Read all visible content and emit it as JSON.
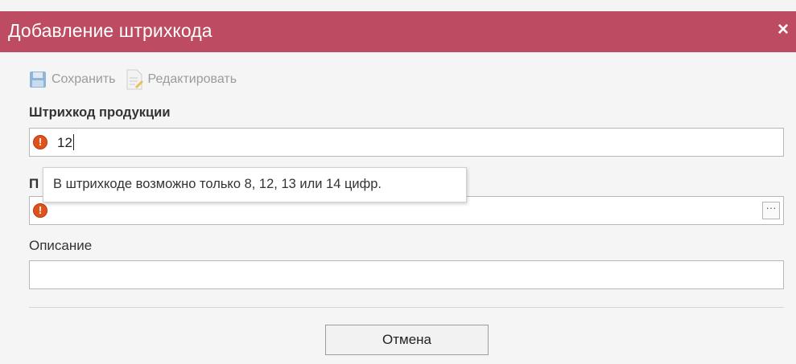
{
  "dialog": {
    "title": "Добавление штрихкода",
    "close_glyph": "×",
    "title_bar_color": "#bd4b61"
  },
  "toolbar": {
    "save_label": "Сохранить",
    "save_icon": "floppy-disk-icon",
    "edit_label": "Редактировать",
    "edit_icon": "document-edit-icon"
  },
  "form": {
    "barcode_label": "Штрихкод продукции",
    "barcode_value": "12",
    "product_label_visible": "П",
    "product_value": "",
    "description_label": "Описание",
    "description_value": "",
    "error_glyph": "!",
    "ellipsis_glyph": "···"
  },
  "tooltip": {
    "text": "В штрихкоде возможно только 8, 12, 13 или 14 цифр."
  },
  "footer": {
    "cancel_label": "Отмена"
  }
}
